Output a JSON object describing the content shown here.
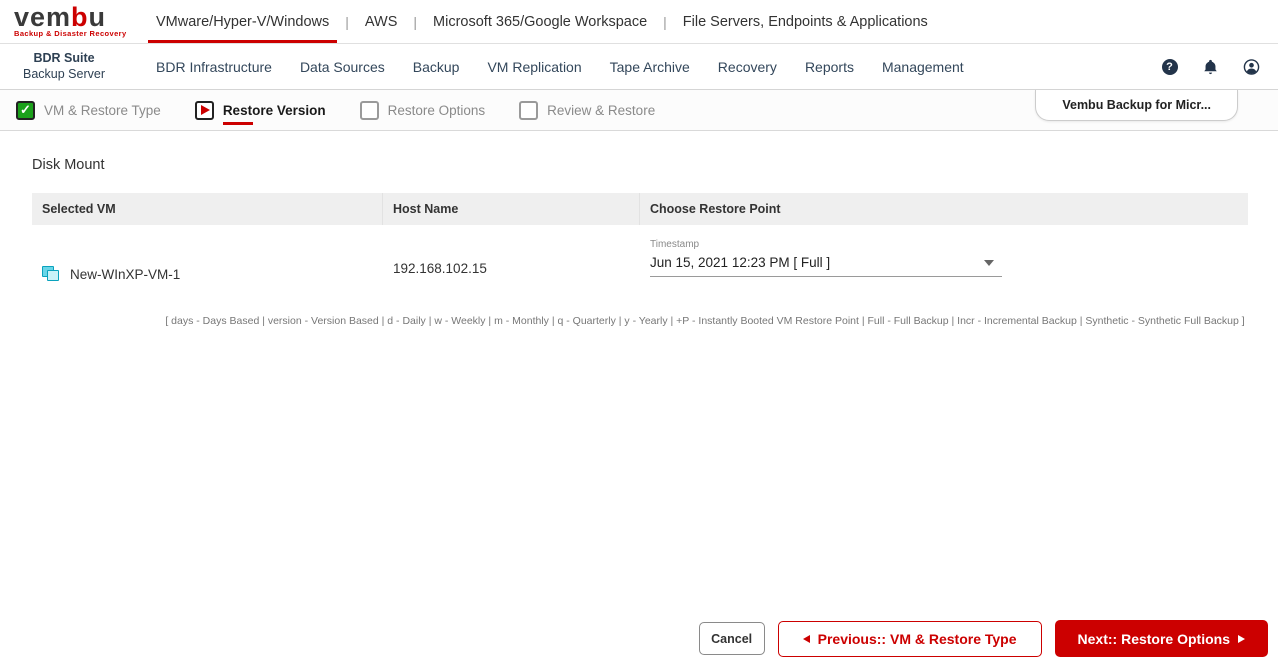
{
  "brand": {
    "logo_parts": [
      "vem",
      "b",
      "u"
    ],
    "tagline": "Backup & Disaster Recovery",
    "accent_color": "#cc0000",
    "navy_color": "#2e4053"
  },
  "top_nav": {
    "separator": "|",
    "items": [
      {
        "label": "VMware/Hyper-V/Windows",
        "active": true
      },
      {
        "label": "AWS",
        "active": false
      },
      {
        "label": "Microsoft 365/Google Workspace",
        "active": false
      },
      {
        "label": "File Servers, Endpoints & Applications",
        "active": false
      }
    ]
  },
  "app_bar": {
    "product_line1": "BDR Suite",
    "product_line2": "Backup Server",
    "menu": [
      "BDR Infrastructure",
      "Data Sources",
      "Backup",
      "VM Replication",
      "Tape Archive",
      "Recovery",
      "Reports",
      "Management"
    ],
    "icons": {
      "help": "question-mark-circle",
      "notifications": "bell",
      "account": "person-circle"
    }
  },
  "wizard": {
    "steps": [
      {
        "label": "VM & Restore Type",
        "state": "completed"
      },
      {
        "label": "Restore Version",
        "state": "current"
      },
      {
        "label": "Restore Options",
        "state": "pending"
      },
      {
        "label": "Review & Restore",
        "state": "pending"
      }
    ],
    "context_tab": "Vembu Backup for Micr..."
  },
  "content": {
    "section_title": "Disk Mount",
    "table": {
      "columns": [
        "Selected VM",
        "Host Name",
        "Choose Restore Point"
      ],
      "rows": [
        {
          "vm_name": "New-WInXP-VM-1",
          "host_name": "192.168.102.15",
          "restore_point_label": "Timestamp",
          "restore_point_value": "Jun 15, 2021 12:23 PM [ Full ]"
        }
      ]
    },
    "legend": "[ days - Days Based | version - Version Based | d - Daily | w - Weekly | m - Monthly | q - Quarterly | y - Yearly | +P - Instantly Booted VM Restore Point | Full - Full Backup | Incr - Incremental Backup | Synthetic - Synthetic Full Backup ]"
  },
  "footer": {
    "cancel_label": "Cancel",
    "previous_label": "Previous:: VM & Restore Type",
    "next_label": "Next:: Restore Options"
  }
}
